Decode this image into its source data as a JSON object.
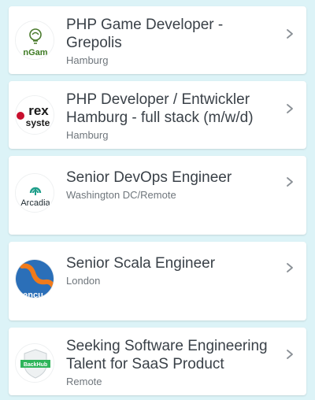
{
  "colors": {
    "background": "#dcf3f7",
    "card": "#ffffff",
    "title_text": "#3a4148",
    "location_text": "#6f767c",
    "chevron": "#8a9096"
  },
  "jobs": [
    {
      "title": "PHP Game Developer - Grepolis",
      "location": "Hamburg",
      "logo_icon": "innogames-logo-icon",
      "logo_text": "nGam"
    },
    {
      "title": "PHP Developer / Entwickler Hamburg - full stack (m/w/d)",
      "location": "Hamburg",
      "logo_icon": "rexsystems-logo-icon",
      "logo_text": "rex syste"
    },
    {
      "title": "Senior DevOps Engineer",
      "location": "Washington DC/Remote",
      "logo_icon": "arcadia-logo-icon",
      "logo_text": "Arcadia"
    },
    {
      "title": "Senior Scala Engineer",
      "location": "London",
      "logo_icon": "company-logo-icon",
      "logo_text": "encu"
    },
    {
      "title": "Seeking Software Engineering Talent for SaaS Product",
      "location": "Remote",
      "logo_icon": "backhub-logo-icon",
      "logo_text": "BackHub"
    }
  ]
}
